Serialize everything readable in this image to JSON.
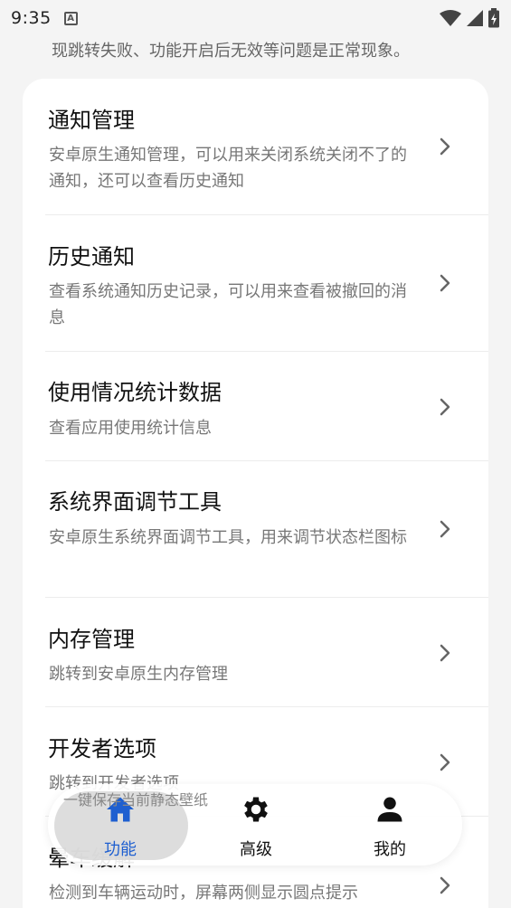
{
  "status_bar": {
    "time": "9:35",
    "notification_icon": "A"
  },
  "notice": "现跳转失败、功能开启后无效等问题是正常现象。",
  "items": [
    {
      "title": "通知管理",
      "desc": "安卓原生通知管理，可以用来关闭系统关闭不了的通知，还可以查看历史通知"
    },
    {
      "title": "历史通知",
      "desc": "查看系统通知历史记录，可以用来查看被撤回的消息"
    },
    {
      "title": "使用情况统计数据",
      "desc": "查看应用使用统计信息"
    },
    {
      "title": "系统界面调节工具",
      "desc": "安卓原生系统界面调节工具，用来调节状态栏图标"
    },
    {
      "title": "内存管理",
      "desc": "跳转到安卓原生内存管理"
    },
    {
      "title": "开发者选项",
      "desc": "跳转到开发者选项"
    },
    {
      "title": "晕车缓解",
      "desc": "检测到车辆运动时，屏幕两侧显示圆点提示"
    }
  ],
  "toast": "一键保存当前静态壁纸",
  "nav": {
    "features": "功能",
    "advanced": "高级",
    "mine": "我的"
  },
  "colors": {
    "accent": "#1e5fd0",
    "background": "#f4f4f4",
    "card": "#ffffff"
  }
}
